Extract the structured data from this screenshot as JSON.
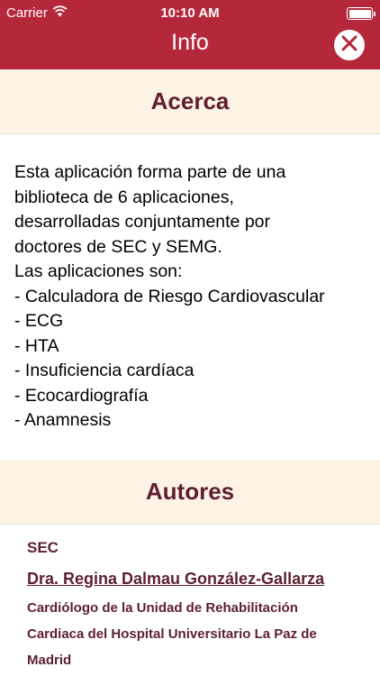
{
  "status_bar": {
    "carrier": "Carrier",
    "time": "10:10 AM"
  },
  "nav": {
    "title": "Info"
  },
  "about": {
    "heading": "Acerca",
    "lines": [
      "Esta aplicación forma parte de una",
      "biblioteca de 6 aplicaciones,",
      "desarrolladas conjuntamente por",
      "doctores de SEC y SEMG.",
      "Las aplicaciones son:",
      "- Calculadora de Riesgo Cardiovascular",
      "- ECG",
      "- HTA",
      "- Insuficiencia cardíaca",
      "- Ecocardiografía",
      "- Anamnesis"
    ]
  },
  "authors": {
    "heading": "Autores",
    "org": "SEC",
    "name": "Dra. Regina Dalmau González-Gallarza",
    "role_lines": [
      "Cardiólogo de la Unidad de Rehabilitación",
      "Cardiaca del Hospital Universitario La Paz de",
      "Madrid"
    ]
  },
  "icons": {
    "wifi": "wifi-icon",
    "battery": "battery-icon",
    "close": "close-icon"
  },
  "colors": {
    "nav_bg": "#b5283c",
    "header_bg": "#fdf3e5",
    "accent_text": "#5e1f30"
  }
}
